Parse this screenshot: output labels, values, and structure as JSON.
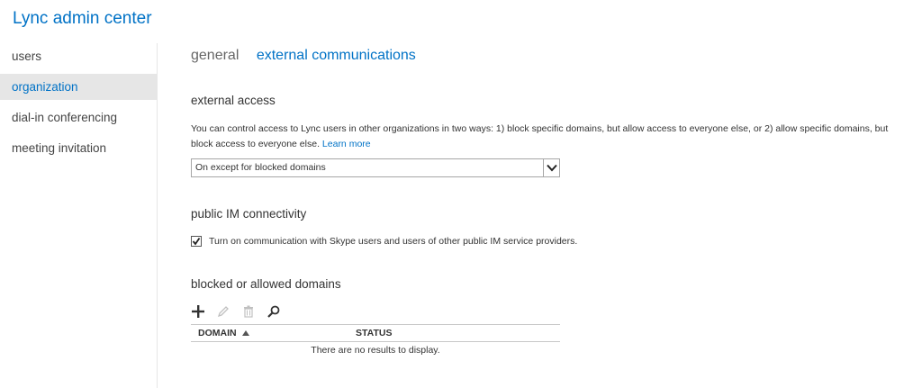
{
  "app": {
    "title": "Lync admin center"
  },
  "sidebar": {
    "items": [
      {
        "label": "users"
      },
      {
        "label": "organization"
      },
      {
        "label": "dial-in conferencing"
      },
      {
        "label": "meeting invitation"
      }
    ]
  },
  "tabs": [
    {
      "label": "general"
    },
    {
      "label": "external communications"
    }
  ],
  "external_access": {
    "title": "external access",
    "description": "You can control access to Lync users in other organizations in two ways: 1) block specific domains, but allow access to everyone else, or 2) allow specific domains, but block access to everyone else.",
    "learn_more": "Learn more",
    "select_value": "On except for blocked domains"
  },
  "public_im": {
    "title": "public IM connectivity",
    "checkbox_label": "Turn on communication with Skype users and users of other public IM service providers.",
    "checked": true
  },
  "domains": {
    "title": "blocked or allowed domains",
    "toolbar": {
      "icons": [
        "add-icon",
        "edit-icon",
        "delete-icon",
        "search-icon"
      ]
    },
    "columns": {
      "domain": "DOMAIN",
      "status": "STATUS"
    },
    "empty_message": "There are no results to display."
  },
  "colors": {
    "accent": "#0072c6",
    "nav_active_bg": "#e6e6e6"
  }
}
